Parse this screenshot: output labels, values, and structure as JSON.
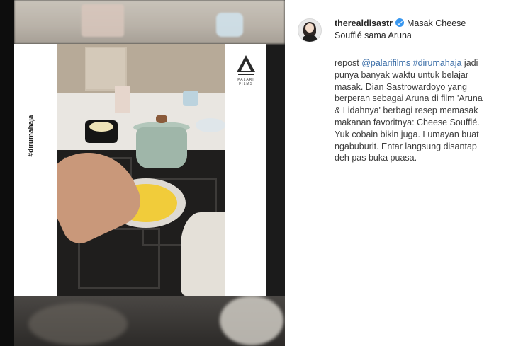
{
  "post": {
    "username": "therealdisastr",
    "title_line1": "Masak Cheese",
    "title_line2": "Soufflé sama Aruna",
    "body": {
      "prefix": "repost ",
      "mention": "@palarifilms",
      "hashtag": " #dirumahaja",
      "lines": [
        " jadi",
        "punya banyak waktu untuk belajar",
        "masak. Dian Sastrowardoyo yang",
        "berperan sebagai Aruna di film 'Aruna",
        "& Lidahnya' berbagi resep memasak",
        "makanan favoritnya: Cheese Soufflé.",
        "Yuk cobain bikin juga. Lumayan buat",
        "ngabuburit. Entar langsung disantap",
        "deh pas buka puasa."
      ]
    }
  },
  "media": {
    "overlay_tag": "#dirumahaja",
    "logo_text": "PALARI FILMS"
  },
  "colors": {
    "verified": "#3897f0",
    "link": "#3b6ea8",
    "text": "#262626"
  },
  "icons": [
    "verified-badge-icon",
    "palari-logo-icon",
    "avatar"
  ]
}
